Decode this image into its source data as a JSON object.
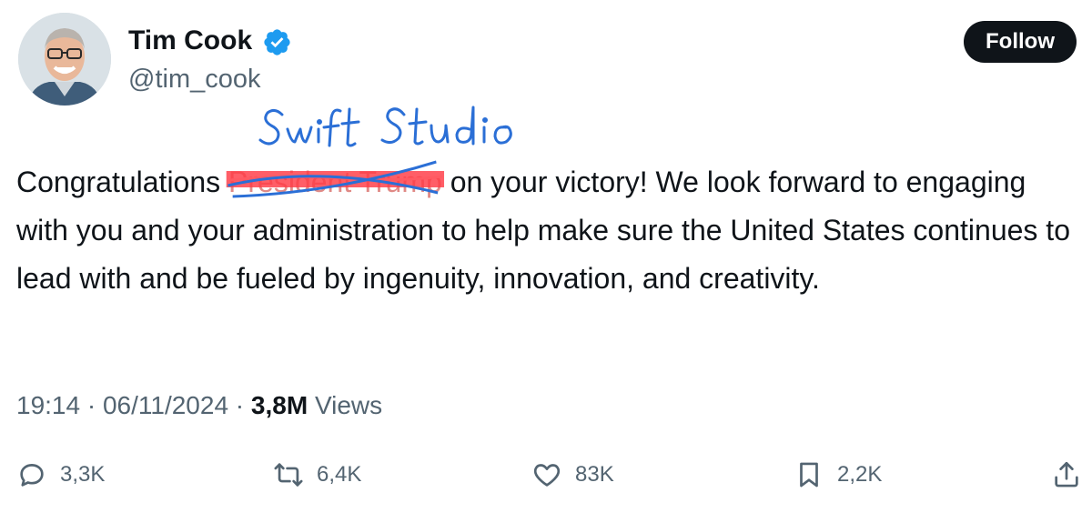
{
  "author": {
    "name": "Tim Cook",
    "handle": "@tim_cook",
    "verified_color": "#1d9bf0"
  },
  "follow_label": "Follow",
  "annotation": {
    "handwritten_text": "Swift Studio",
    "ink_color": "#2b6fd6",
    "scribble_color": "#ff3b45"
  },
  "tweet": {
    "text_before": "Congratulations ",
    "struck_text": "President Trump",
    "text_after": " on your victory!  We look forward to engaging with you and your administration to help make sure the United States continues to lead with and be fueled by ingenuity, innovation, and creativity."
  },
  "meta": {
    "time": "19:14",
    "date": "06/11/2024",
    "views_count": "3,8M",
    "views_label": "Views"
  },
  "actions": {
    "replies": "3,3K",
    "reposts": "6,4K",
    "likes": "83K",
    "bookmarks": "2,2K"
  }
}
